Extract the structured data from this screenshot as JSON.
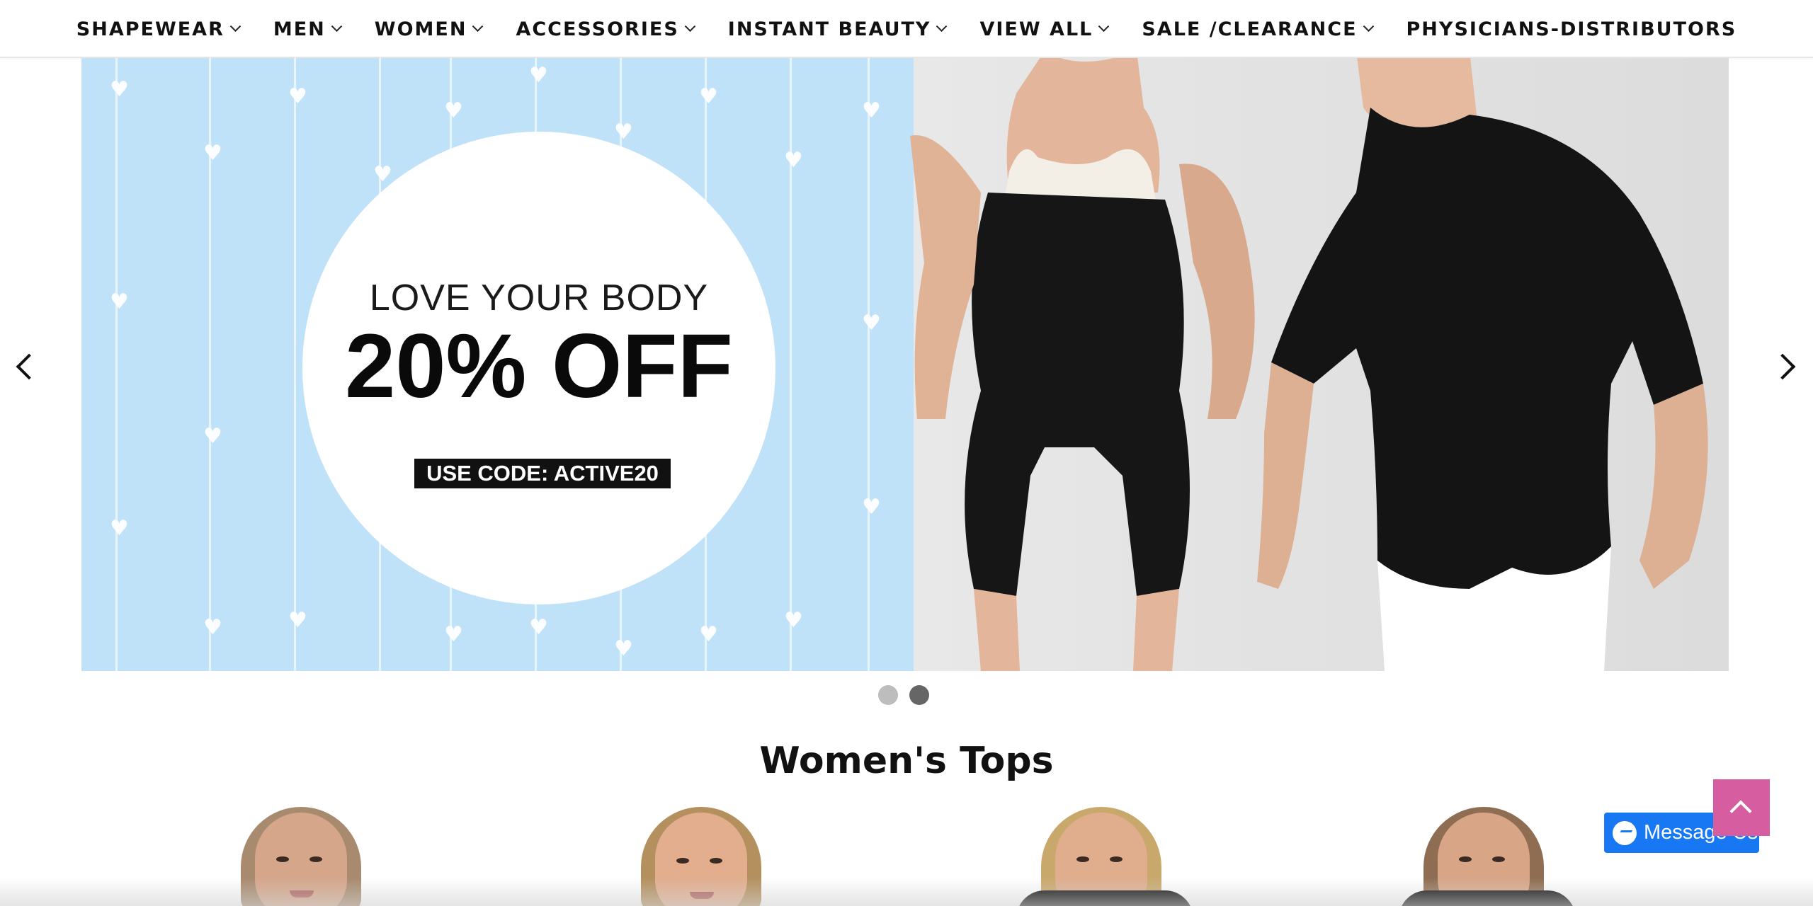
{
  "nav": {
    "items": [
      {
        "label": "SHAPEWEAR",
        "dropdown": true
      },
      {
        "label": "MEN",
        "dropdown": true
      },
      {
        "label": "WOMEN",
        "dropdown": true
      },
      {
        "label": "ACCESSORIES",
        "dropdown": true
      },
      {
        "label": "INSTANT BEAUTY",
        "dropdown": true
      },
      {
        "label": "VIEW ALL",
        "dropdown": true
      },
      {
        "label": "SALE /CLEARANCE",
        "dropdown": true
      },
      {
        "label": "PHYSICIANS-DISTRIBUTORS",
        "dropdown": false
      }
    ]
  },
  "hero": {
    "line1": "LOVE YOUR BODY",
    "line2": "20% OFF",
    "code": "USE CODE: ACTIVE20",
    "slide_count": 2,
    "active_slide": 2,
    "colors": {
      "sky": "#bfe2f8",
      "studio": "#e2e2e2"
    }
  },
  "section": {
    "title": "Women's Tops"
  },
  "widgets": {
    "messenger_label": "Message Us",
    "messenger_color": "#1877f2",
    "back_to_top_color": "#d65da0"
  },
  "icons": [
    "chevron-down-icon",
    "chevron-left-icon",
    "chevron-right-icon",
    "messenger-icon",
    "arrow-up-icon"
  ]
}
